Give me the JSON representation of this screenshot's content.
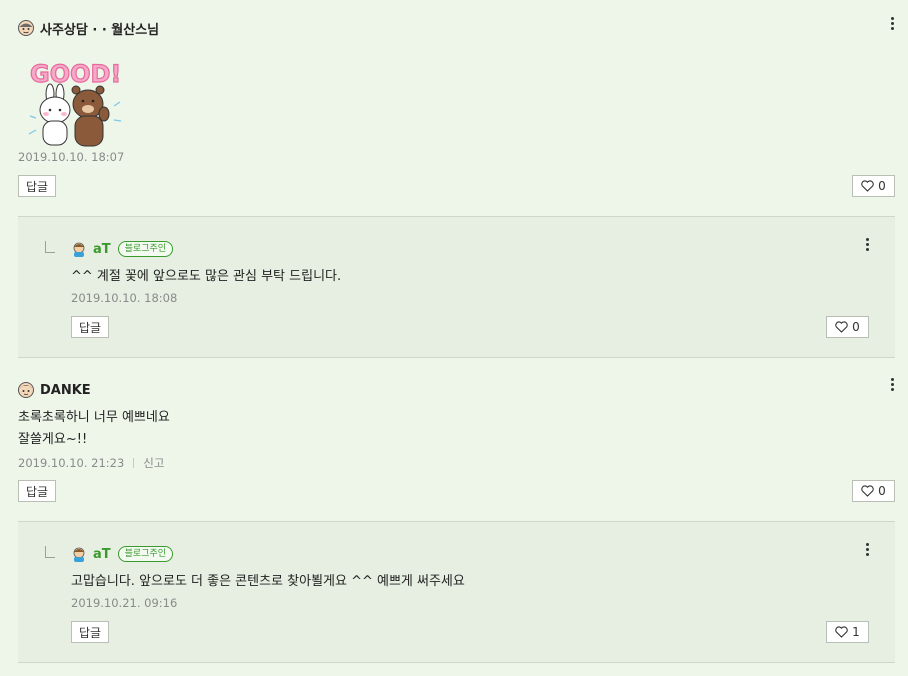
{
  "comments": [
    {
      "author": "사주상담 · · 월산스님",
      "sticker": "GOOD!",
      "date": "2019.10.10. 18:07",
      "reply_label": "답글",
      "likes": "0",
      "avatar_icon": "old-man-avatar-icon",
      "reply": {
        "author": "aT",
        "badge": "블로그주인",
        "text": "^^ 계절 꽃에 앞으로도 많은 관심 부탁 드립니다.",
        "date": "2019.10.10. 18:08",
        "reply_label": "답글",
        "likes": "0"
      }
    },
    {
      "author": "DANKE",
      "text_line1": "초록초록하니 너무 예쁘네요",
      "text_line2": "잘쓸게요~!!",
      "date": "2019.10.10. 21:23",
      "report_label": "신고",
      "reply_label": "답글",
      "likes": "0",
      "reply": {
        "author": "aT",
        "badge": "블로그주인",
        "text": "고맙습니다. 앞으로도 더 좋은 콘텐츠로 찾아뵐게요 ^^ 예쁘게 써주세요",
        "date": "2019.10.21. 09:16",
        "reply_label": "답글",
        "likes": "1"
      }
    }
  ],
  "colors": {
    "background": "#eef6ea",
    "reply_background": "#e6efe1",
    "owner_green": "#3a9a2e"
  }
}
